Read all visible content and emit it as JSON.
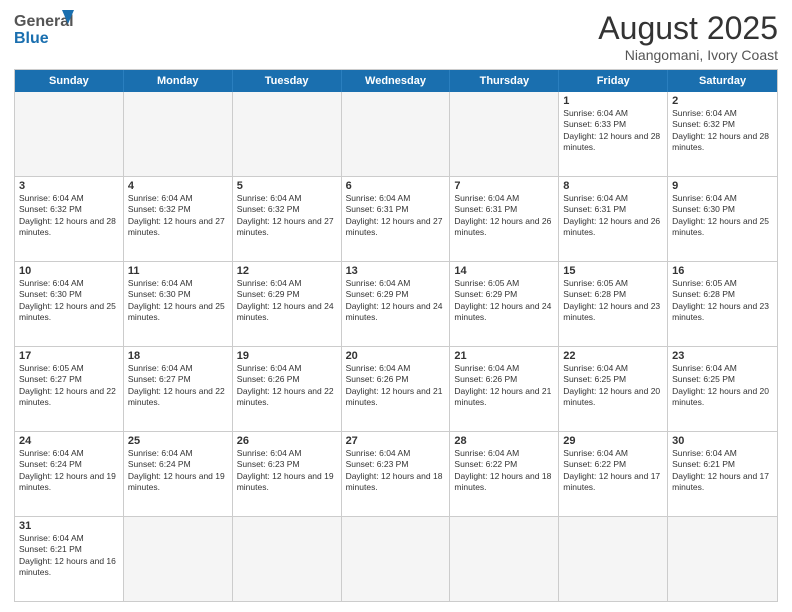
{
  "header": {
    "logo_general": "General",
    "logo_blue": "Blue",
    "month_title": "August 2025",
    "subtitle": "Niangomani, Ivory Coast"
  },
  "weekdays": [
    "Sunday",
    "Monday",
    "Tuesday",
    "Wednesday",
    "Thursday",
    "Friday",
    "Saturday"
  ],
  "rows": [
    [
      {
        "day": "",
        "empty": true
      },
      {
        "day": "",
        "empty": true
      },
      {
        "day": "",
        "empty": true
      },
      {
        "day": "",
        "empty": true
      },
      {
        "day": "",
        "empty": true
      },
      {
        "day": "1",
        "info": "Sunrise: 6:04 AM\nSunset: 6:33 PM\nDaylight: 12 hours and 28 minutes."
      },
      {
        "day": "2",
        "info": "Sunrise: 6:04 AM\nSunset: 6:32 PM\nDaylight: 12 hours and 28 minutes."
      }
    ],
    [
      {
        "day": "3",
        "info": "Sunrise: 6:04 AM\nSunset: 6:32 PM\nDaylight: 12 hours and 28 minutes."
      },
      {
        "day": "4",
        "info": "Sunrise: 6:04 AM\nSunset: 6:32 PM\nDaylight: 12 hours and 27 minutes."
      },
      {
        "day": "5",
        "info": "Sunrise: 6:04 AM\nSunset: 6:32 PM\nDaylight: 12 hours and 27 minutes."
      },
      {
        "day": "6",
        "info": "Sunrise: 6:04 AM\nSunset: 6:31 PM\nDaylight: 12 hours and 27 minutes."
      },
      {
        "day": "7",
        "info": "Sunrise: 6:04 AM\nSunset: 6:31 PM\nDaylight: 12 hours and 26 minutes."
      },
      {
        "day": "8",
        "info": "Sunrise: 6:04 AM\nSunset: 6:31 PM\nDaylight: 12 hours and 26 minutes."
      },
      {
        "day": "9",
        "info": "Sunrise: 6:04 AM\nSunset: 6:30 PM\nDaylight: 12 hours and 25 minutes."
      }
    ],
    [
      {
        "day": "10",
        "info": "Sunrise: 6:04 AM\nSunset: 6:30 PM\nDaylight: 12 hours and 25 minutes."
      },
      {
        "day": "11",
        "info": "Sunrise: 6:04 AM\nSunset: 6:30 PM\nDaylight: 12 hours and 25 minutes."
      },
      {
        "day": "12",
        "info": "Sunrise: 6:04 AM\nSunset: 6:29 PM\nDaylight: 12 hours and 24 minutes."
      },
      {
        "day": "13",
        "info": "Sunrise: 6:04 AM\nSunset: 6:29 PM\nDaylight: 12 hours and 24 minutes."
      },
      {
        "day": "14",
        "info": "Sunrise: 6:05 AM\nSunset: 6:29 PM\nDaylight: 12 hours and 24 minutes."
      },
      {
        "day": "15",
        "info": "Sunrise: 6:05 AM\nSunset: 6:28 PM\nDaylight: 12 hours and 23 minutes."
      },
      {
        "day": "16",
        "info": "Sunrise: 6:05 AM\nSunset: 6:28 PM\nDaylight: 12 hours and 23 minutes."
      }
    ],
    [
      {
        "day": "17",
        "info": "Sunrise: 6:05 AM\nSunset: 6:27 PM\nDaylight: 12 hours and 22 minutes."
      },
      {
        "day": "18",
        "info": "Sunrise: 6:04 AM\nSunset: 6:27 PM\nDaylight: 12 hours and 22 minutes."
      },
      {
        "day": "19",
        "info": "Sunrise: 6:04 AM\nSunset: 6:26 PM\nDaylight: 12 hours and 22 minutes."
      },
      {
        "day": "20",
        "info": "Sunrise: 6:04 AM\nSunset: 6:26 PM\nDaylight: 12 hours and 21 minutes."
      },
      {
        "day": "21",
        "info": "Sunrise: 6:04 AM\nSunset: 6:26 PM\nDaylight: 12 hours and 21 minutes."
      },
      {
        "day": "22",
        "info": "Sunrise: 6:04 AM\nSunset: 6:25 PM\nDaylight: 12 hours and 20 minutes."
      },
      {
        "day": "23",
        "info": "Sunrise: 6:04 AM\nSunset: 6:25 PM\nDaylight: 12 hours and 20 minutes."
      }
    ],
    [
      {
        "day": "24",
        "info": "Sunrise: 6:04 AM\nSunset: 6:24 PM\nDaylight: 12 hours and 19 minutes."
      },
      {
        "day": "25",
        "info": "Sunrise: 6:04 AM\nSunset: 6:24 PM\nDaylight: 12 hours and 19 minutes."
      },
      {
        "day": "26",
        "info": "Sunrise: 6:04 AM\nSunset: 6:23 PM\nDaylight: 12 hours and 19 minutes."
      },
      {
        "day": "27",
        "info": "Sunrise: 6:04 AM\nSunset: 6:23 PM\nDaylight: 12 hours and 18 minutes."
      },
      {
        "day": "28",
        "info": "Sunrise: 6:04 AM\nSunset: 6:22 PM\nDaylight: 12 hours and 18 minutes."
      },
      {
        "day": "29",
        "info": "Sunrise: 6:04 AM\nSunset: 6:22 PM\nDaylight: 12 hours and 17 minutes."
      },
      {
        "day": "30",
        "info": "Sunrise: 6:04 AM\nSunset: 6:21 PM\nDaylight: 12 hours and 17 minutes."
      }
    ],
    [
      {
        "day": "31",
        "info": "Sunrise: 6:04 AM\nSunset: 6:21 PM\nDaylight: 12 hours and 16 minutes."
      },
      {
        "day": "",
        "empty": true
      },
      {
        "day": "",
        "empty": true
      },
      {
        "day": "",
        "empty": true
      },
      {
        "day": "",
        "empty": true
      },
      {
        "day": "",
        "empty": true
      },
      {
        "day": "",
        "empty": true
      }
    ]
  ]
}
